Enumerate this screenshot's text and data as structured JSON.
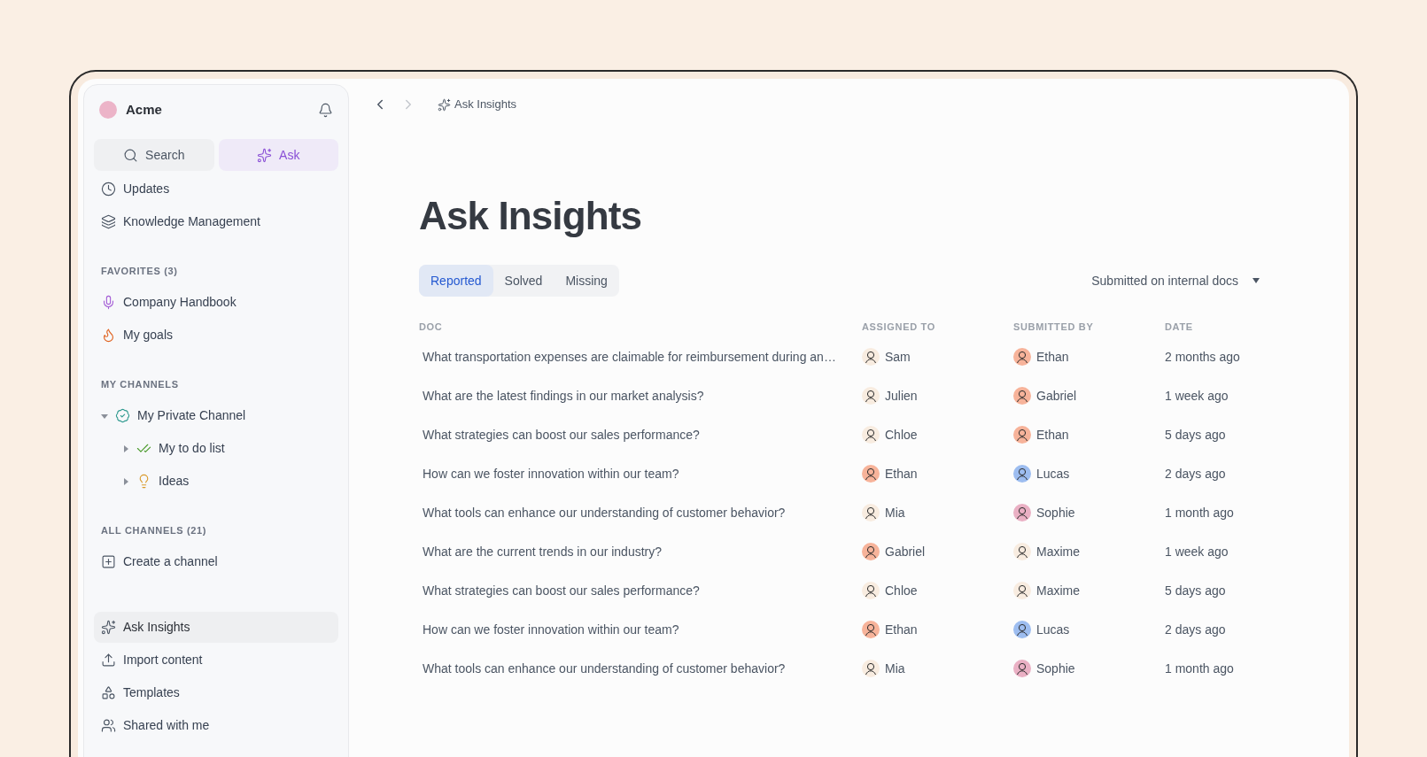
{
  "workspace": {
    "name": "Acme",
    "color": "#ecb4c8"
  },
  "sidebar": {
    "actions": [
      {
        "label": "Search",
        "kind": "search",
        "selected": false
      },
      {
        "label": "Ask",
        "kind": "ask",
        "selected": true
      }
    ],
    "top_items": [
      {
        "label": "Updates",
        "kind": "clock"
      },
      {
        "label": "Knowledge Management",
        "kind": "layers"
      }
    ],
    "sections": [
      {
        "title": "FAVORITES (3)",
        "items": [
          {
            "label": "Company Handbook",
            "kind": "mic"
          },
          {
            "label": "My goals",
            "kind": "fire"
          }
        ]
      },
      {
        "title": "MY CHANNELS",
        "items": [
          {
            "label": "My Private Channel",
            "kind": "badge",
            "expanded": true,
            "children": [
              {
                "label": "My to do list",
                "kind": "check",
                "expanded": false
              },
              {
                "label": "Ideas",
                "kind": "bulb",
                "expanded": false
              }
            ]
          }
        ]
      },
      {
        "title": "ALL CHANNELS (21)",
        "items": [
          {
            "label": "Create a channel",
            "kind": "create"
          }
        ]
      }
    ],
    "bottom_items": [
      {
        "label": "Ask Insights",
        "kind": "sparkle",
        "selected": true
      },
      {
        "label": "Import content",
        "kind": "upload",
        "selected": false
      },
      {
        "label": "Templates",
        "kind": "shapes",
        "selected": false
      },
      {
        "label": "Shared with me",
        "kind": "people",
        "selected": false
      }
    ]
  },
  "breadcrumb": "Ask Insights",
  "title": "Ask Insights",
  "tabs": [
    {
      "label": "Reported",
      "selected": true
    },
    {
      "label": "Solved",
      "selected": false
    },
    {
      "label": "Missing",
      "selected": false
    }
  ],
  "filter": "Submitted on internal docs",
  "table": {
    "columns": [
      "DOC",
      "ASSIGNED TO",
      "SUBMITTED BY",
      "DATE"
    ],
    "rows": [
      {
        "doc": "What transportation expenses are claimable for reimbursement during an…",
        "assigned": {
          "name": "Sam",
          "color": "#f8ece0"
        },
        "submitted": {
          "name": "Ethan",
          "color": "#f7b39a"
        },
        "date": "2 months ago"
      },
      {
        "doc": "What are the latest findings in our market analysis?",
        "assigned": {
          "name": "Julien",
          "color": "#f8ece0"
        },
        "submitted": {
          "name": "Gabriel",
          "color": "#f7b39a"
        },
        "date": "1 week ago"
      },
      {
        "doc": "What strategies can boost our sales performance?",
        "assigned": {
          "name": "Chloe",
          "color": "#f8ece0"
        },
        "submitted": {
          "name": "Ethan",
          "color": "#f7b39a"
        },
        "date": "5 days ago"
      },
      {
        "doc": "How can we foster innovation within our team?",
        "assigned": {
          "name": "Ethan",
          "color": "#f7b39a"
        },
        "submitted": {
          "name": "Lucas",
          "color": "#9dbdf0"
        },
        "date": "2 days ago"
      },
      {
        "doc": "What tools can enhance our understanding of customer behavior?",
        "assigned": {
          "name": "Mia",
          "color": "#f8ece0"
        },
        "submitted": {
          "name": "Sophie",
          "color": "#eab0c4"
        },
        "date": "1 month ago"
      },
      {
        "doc": "What are the current trends in our industry?",
        "assigned": {
          "name": "Gabriel",
          "color": "#f7b39a"
        },
        "submitted": {
          "name": "Maxime",
          "color": "#f8ece0"
        },
        "date": "1 week ago"
      },
      {
        "doc": "What strategies can boost our sales performance?",
        "assigned": {
          "name": "Chloe",
          "color": "#f8ece0"
        },
        "submitted": {
          "name": "Maxime",
          "color": "#f8ece0"
        },
        "date": "5 days ago"
      },
      {
        "doc": "How can we foster innovation within our team?",
        "assigned": {
          "name": "Ethan",
          "color": "#f7b39a"
        },
        "submitted": {
          "name": "Lucas",
          "color": "#9dbdf0"
        },
        "date": "2 days ago"
      },
      {
        "doc": "What tools can enhance our understanding of customer behavior?",
        "assigned": {
          "name": "Mia",
          "color": "#f8ece0"
        },
        "submitted": {
          "name": "Sophie",
          "color": "#eab0c4"
        },
        "date": "1 month ago"
      }
    ]
  }
}
